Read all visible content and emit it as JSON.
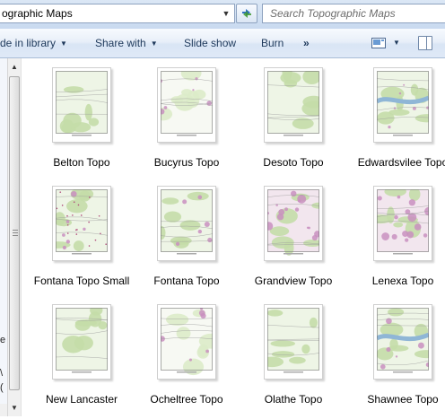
{
  "address": {
    "path": "ographic Maps"
  },
  "search": {
    "placeholder": "Search Topographic Maps"
  },
  "commands": {
    "include_in_library": "de in library",
    "share_with": "Share with",
    "slide_show": "Slide show",
    "burn": "Burn",
    "more": "»"
  },
  "nav_pane": {
    "fragments": [
      "e",
      "\\",
      "("
    ]
  },
  "files": [
    {
      "name": "Belton Topo",
      "style": "green"
    },
    {
      "name": "Bucyrus Topo",
      "style": "pale"
    },
    {
      "name": "Desoto Topo",
      "style": "green"
    },
    {
      "name": "Edwardsvilee Topo",
      "style": "river"
    },
    {
      "name": "Fontana Topo Small",
      "style": "dots"
    },
    {
      "name": "Fontana Topo",
      "style": "green"
    },
    {
      "name": "Grandview Topo",
      "style": "urban"
    },
    {
      "name": "Lenexa Topo",
      "style": "urban"
    },
    {
      "name": "New Lancaster",
      "style": "green"
    },
    {
      "name": "Ocheltree Topo",
      "style": "pale"
    },
    {
      "name": "Olathe Topo",
      "style": "green"
    },
    {
      "name": "Shawnee Topo",
      "style": "river"
    }
  ],
  "colors": {
    "command_text": "#1e395b",
    "map_green": "#cfe3b8",
    "map_urban": "#d9a6c8",
    "map_water": "#9fc3df"
  }
}
